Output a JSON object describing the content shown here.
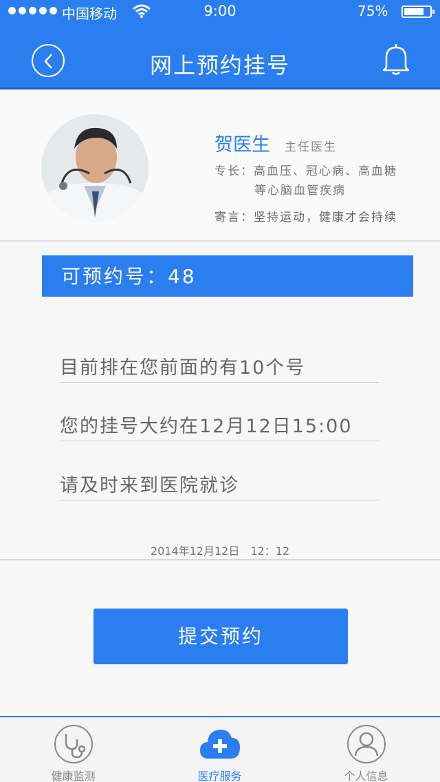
{
  "status_bar": {
    "carrier": "中国移动",
    "time": "9:00",
    "battery": "75%"
  },
  "header": {
    "title": "网上预约挂号"
  },
  "doctor": {
    "name": "贺医生",
    "title": "主任医生",
    "specialty_line1": "专长：高血压、冠心病、高血糖",
    "specialty_line2": "等心脑血管疾病",
    "motto": "寄言：坚持运动，健康才会持续"
  },
  "availability": {
    "label": "可预约号：48"
  },
  "info": {
    "line1": "目前排在您前面的有10个号",
    "line2": "您的挂号大约在12月12日15:00",
    "line3": "请及时来到医院就诊"
  },
  "timestamp": "2014年12月12日　12：12",
  "submit": {
    "label": "提交预约"
  },
  "tabs": [
    {
      "label": "健康监测",
      "icon": "stethoscope-icon"
    },
    {
      "label": "医疗服务",
      "icon": "cloud-plus-icon",
      "active": true
    },
    {
      "label": "个人信息",
      "icon": "person-icon"
    }
  ],
  "colors": {
    "primary": "#2a7ef0",
    "header_border": "#1a63c8"
  }
}
